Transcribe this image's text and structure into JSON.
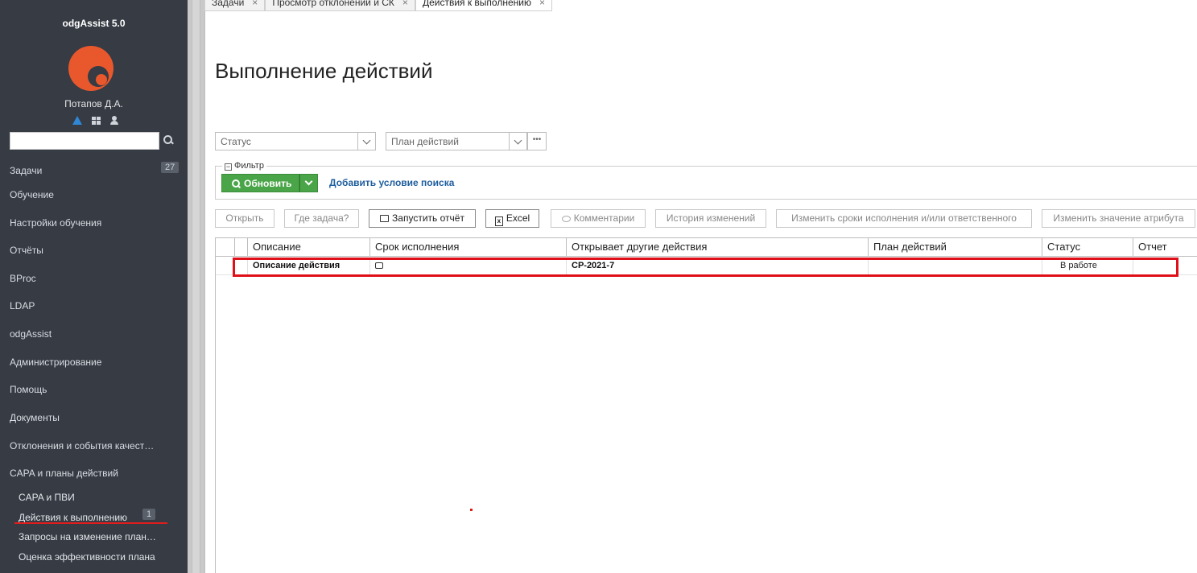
{
  "sidebar": {
    "app_title": "odgAssist 5.0",
    "username": "Потапов Д.А.",
    "search": {
      "value": "",
      "placeholder": ""
    },
    "items": [
      {
        "label": "Задачи",
        "badge": "27"
      },
      {
        "label": "Обучение"
      },
      {
        "label": "Настройки обучения"
      },
      {
        "label": "Отчёты"
      },
      {
        "label": "BProc"
      },
      {
        "label": "LDAP"
      },
      {
        "label": "odgAssist"
      },
      {
        "label": "Администрирование"
      },
      {
        "label": "Помощь"
      },
      {
        "label": "Документы"
      },
      {
        "label": "Отклонения и события качест…"
      },
      {
        "label": "CAPA и планы действий"
      }
    ],
    "subitems": [
      {
        "label": "CAPA и ПВИ"
      },
      {
        "label": "Действия к выполнению",
        "badge": "1"
      },
      {
        "label": "Запросы на изменение план…"
      },
      {
        "label": "Оценка эффективности плана"
      }
    ]
  },
  "tabs": [
    {
      "label": "Задачи"
    },
    {
      "label": "Просмотр отклонений и СК"
    },
    {
      "label": "Действия к выполнению",
      "active": true
    }
  ],
  "tab_close": "×",
  "main": {
    "title": "Выполнение действий",
    "status_combo": {
      "placeholder": "Статус"
    },
    "plan_combo": {
      "placeholder": "План действий"
    },
    "dots": "•••",
    "filter": {
      "legend": "Фильтр",
      "collapse": "−",
      "refresh_label": "Обновить",
      "add_condition": "Добавить условие поиска"
    },
    "toolbar": {
      "open": "Открыть",
      "where_task": "Где задача?",
      "run_report": "Запустить отчёт",
      "excel": "Excel",
      "comments": "Комментарии",
      "history": "История изменений",
      "change_deadlines": "Изменить сроки исполнения и/или ответственного",
      "change_attribute": "Изменить значение атрибута"
    },
    "grid": {
      "columns": [
        "Описание",
        "Срок исполнения",
        "Открывает другие действия",
        "План действий",
        "Статус",
        "Отчет"
      ],
      "rows": [
        {
          "description": "Описание действия",
          "deadline": "",
          "opens": "CP-2021-7",
          "plan": "",
          "status": "В работе",
          "report": ""
        }
      ]
    }
  },
  "colors": {
    "sidebar_bg": "#363b44",
    "accent_green": "#4aa548",
    "logo_orange": "#e8582c",
    "highlight_red": "#e0101a",
    "link_blue": "#1f5e9e"
  }
}
